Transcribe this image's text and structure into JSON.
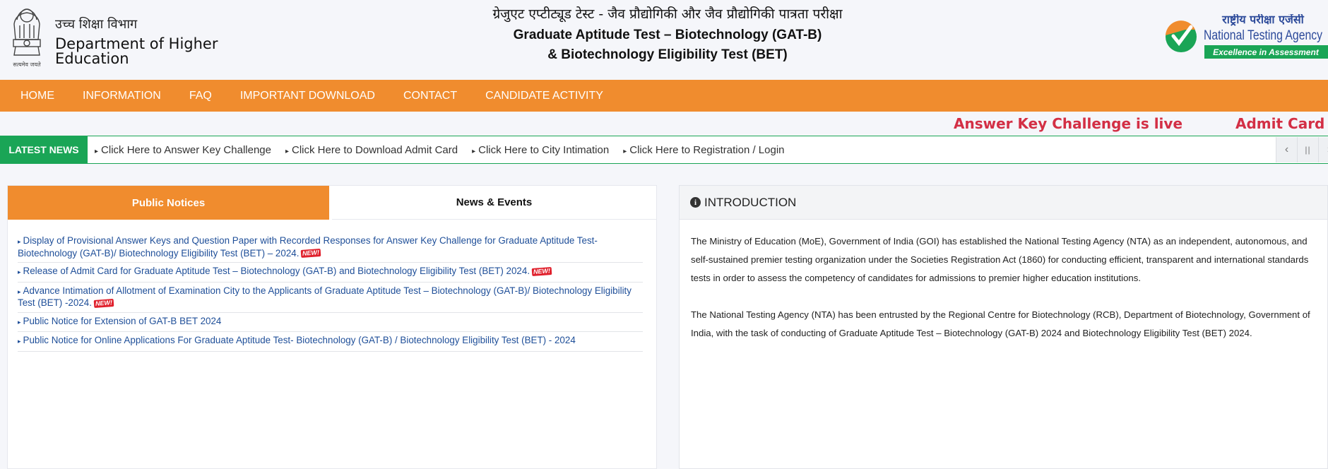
{
  "header": {
    "dept_hindi": "उच्च शिक्षा विभाग",
    "dept_english": "Department of Higher Education",
    "emblem_motto": "सत्यमेव जयते",
    "title_hindi": "ग्रेजुएट एप्टीट्यूड टेस्ट - जैव प्रौद्योगिकी और जैव प्रौद्योगिकी पात्रता परीक्षा",
    "title_line1": "Graduate Aptitude Test – Biotechnology (GAT-B)",
    "title_line2": "& Biotechnology Eligibility Test (BET)",
    "nta_hindi": "राष्ट्रीय परीक्षा एजेंसी",
    "nta_english": "National Testing Agency",
    "nta_tagline": "Excellence in Assessment"
  },
  "nav": [
    "HOME",
    "INFORMATION",
    "FAQ",
    "IMPORTANT DOWNLOAD",
    "CONTACT",
    "CANDIDATE ACTIVITY"
  ],
  "marquee": [
    "Answer Key Challenge is live",
    "Admit Card"
  ],
  "latest_news": {
    "label": "LATEST NEWS",
    "items": [
      "Click Here to Answer Key Challenge",
      "Click Here to Download Admit Card",
      "Click Here to City Intimation",
      "Click Here to Registration / Login"
    ]
  },
  "tabs": [
    "Public Notices",
    "News & Events"
  ],
  "notices": [
    {
      "text": "Display of Provisional Answer Keys and Question Paper with Recorded Responses for Answer Key Challenge for Graduate Aptitude Test- Biotechnology (GAT-B)/ Biotechnology Eligibility Test (BET) – 2024.",
      "new": true
    },
    {
      "text": "Release of Admit Card for Graduate Aptitude Test – Biotechnology (GAT-B) and Biotechnology Eligibility Test (BET) 2024.",
      "new": true
    },
    {
      "text": "Advance Intimation of Allotment of Examination City to the Applicants of Graduate Aptitude Test – Biotechnology (GAT-B)/ Biotechnology Eligibility Test (BET) -2024.",
      "new": true
    },
    {
      "text": "Public Notice for Extension of GAT-B BET 2024",
      "new": false
    },
    {
      "text": "Public Notice for Online Applications For Graduate Aptitude Test- Biotechnology (GAT-B) / Biotechnology Eligibility Test (BET) - 2024",
      "new": false
    }
  ],
  "new_badge": "NEW!",
  "intro": {
    "title": "INTRODUCTION",
    "paragraphs": [
      "The Ministry of Education (MoE), Government of India (GOI) has established the National Testing Agency (NTA) as an independent, autonomous, and self-sustained premier testing organization under the Societies Registration Act (1860) for conducting efficient, transparent and international standards tests in order to assess the competency of candidates for admissions to premier higher education institutions.",
      "The National Testing Agency (NTA) has been entrusted by the Regional Centre for Biotechnology (RCB), Department of Biotechnology, Government of India, with the task of conducting of Graduate Aptitude Test – Biotechnology (GAT-B) 2024 and Biotechnology Eligibility Test (BET) 2024."
    ]
  },
  "colors": {
    "nav_bg": "#f08c2e",
    "news_green": "#1aa556",
    "marquee_red": "#d32f45",
    "link_blue": "#1f4f99"
  }
}
